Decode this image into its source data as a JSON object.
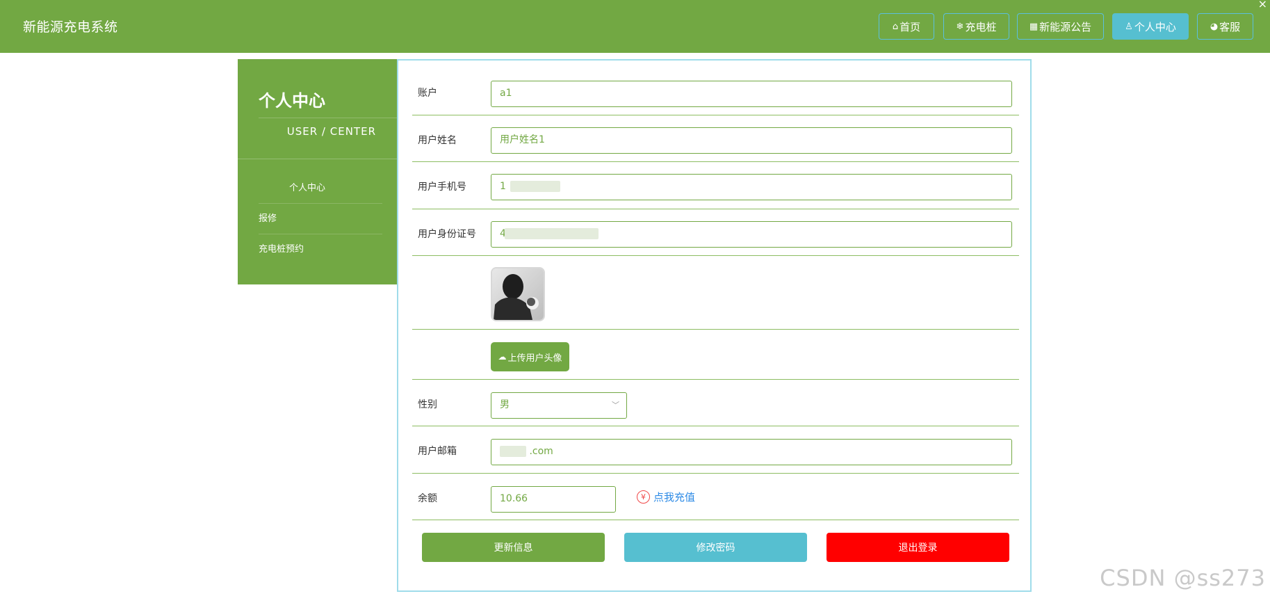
{
  "header": {
    "title": "新能源充电系统",
    "close_glyph": "×",
    "nav": [
      {
        "label": "首页",
        "icon": "home-icon",
        "glyph": "⌂"
      },
      {
        "label": "充电桩",
        "icon": "snowflake-icon",
        "glyph": "❄"
      },
      {
        "label": "新能源公告",
        "icon": "bulletin-icon",
        "glyph": "▦"
      },
      {
        "label": "个人中心",
        "icon": "user-icon",
        "glyph": "♙"
      },
      {
        "label": "客服",
        "icon": "support-icon",
        "glyph": "◕"
      }
    ],
    "active_nav": "个人中心"
  },
  "sidebar": {
    "title": "个人中心",
    "subtitle": "USER / CENTER",
    "items": [
      {
        "label": "个人中心"
      },
      {
        "label": "报修"
      },
      {
        "label": "充电桩预约"
      }
    ]
  },
  "form": {
    "account": {
      "label": "账户",
      "value": "a1"
    },
    "name": {
      "label": "用户姓名",
      "value": "用户姓名1"
    },
    "phone": {
      "label": "用户手机号",
      "value": "1"
    },
    "id_card": {
      "label": "用户身份证号",
      "value": "4"
    },
    "upload_label": "上传用户头像",
    "gender": {
      "label": "性别",
      "value": "男"
    },
    "email": {
      "label": "用户邮箱",
      "value": ".com"
    },
    "balance": {
      "label": "余额",
      "value": "10.66",
      "recharge_label": "点我充值",
      "currency_glyph": "¥"
    }
  },
  "actions": {
    "update": "更新信息",
    "change_password": "修改密码",
    "logout": "退出登录"
  },
  "colors": {
    "brand_green": "#72a843",
    "active_nav": "#56bfd0",
    "logout_red": "#ff0000",
    "link_blue": "#2e8be6"
  },
  "watermark": "CSDN @ss273"
}
